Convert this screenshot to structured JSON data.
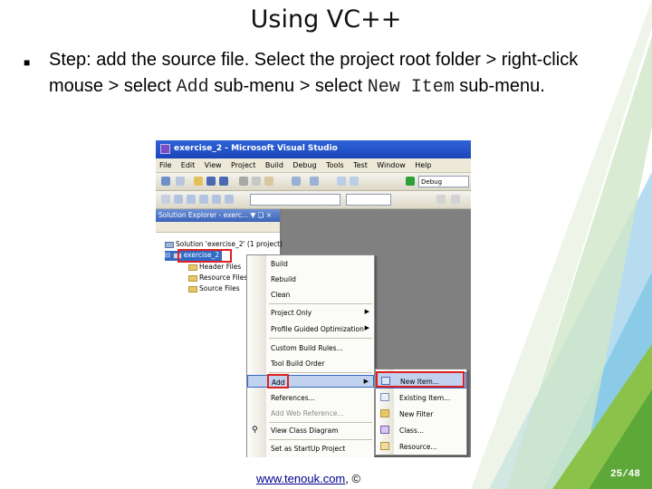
{
  "slide": {
    "title": "Using VC++",
    "bullet_prefix": "Step: add the source file. Select the project root folder > right-click mouse > select ",
    "bullet_code1": "Add",
    "bullet_mid": " sub-menu > select ",
    "bullet_code2": "New Item",
    "bullet_suffix": " sub-menu.",
    "footer_link": "www.tenouk.com",
    "footer_copyright": ", ©",
    "page_number": "25/48"
  },
  "vs": {
    "window_title": "exercise_2 - Microsoft Visual Studio",
    "menu": [
      "File",
      "Edit",
      "View",
      "Project",
      "Build",
      "Debug",
      "Tools",
      "Test",
      "Window",
      "Help"
    ],
    "config_value": "Debug",
    "solution_explorer": {
      "title": "Solution Explorer - exerc...  ▼ ❑ ×",
      "tree": [
        "Solution 'exercise_2' (1 project)",
        "exercise_2",
        "Header Files",
        "Resource Files",
        "Source Files"
      ]
    },
    "context_menu": [
      "Build",
      "Rebuild",
      "Clean",
      "Project Only",
      "Profile Guided Optimization",
      "Custom Build Rules...",
      "Tool Build Order",
      "Add",
      "References...",
      "Add Web Reference...",
      "View Class Diagram",
      "Set as StartUp Project"
    ],
    "add_submenu": [
      "New Item...",
      "Existing Item...",
      "New Filter",
      "Class...",
      "Resource..."
    ]
  },
  "colors": {
    "title_bar": "#1a45b8",
    "highlight": "#c1d2ee",
    "selection_outline": "#e02020",
    "deco_green": "#8bc34a",
    "deco_blue": "#4fa8dc"
  }
}
